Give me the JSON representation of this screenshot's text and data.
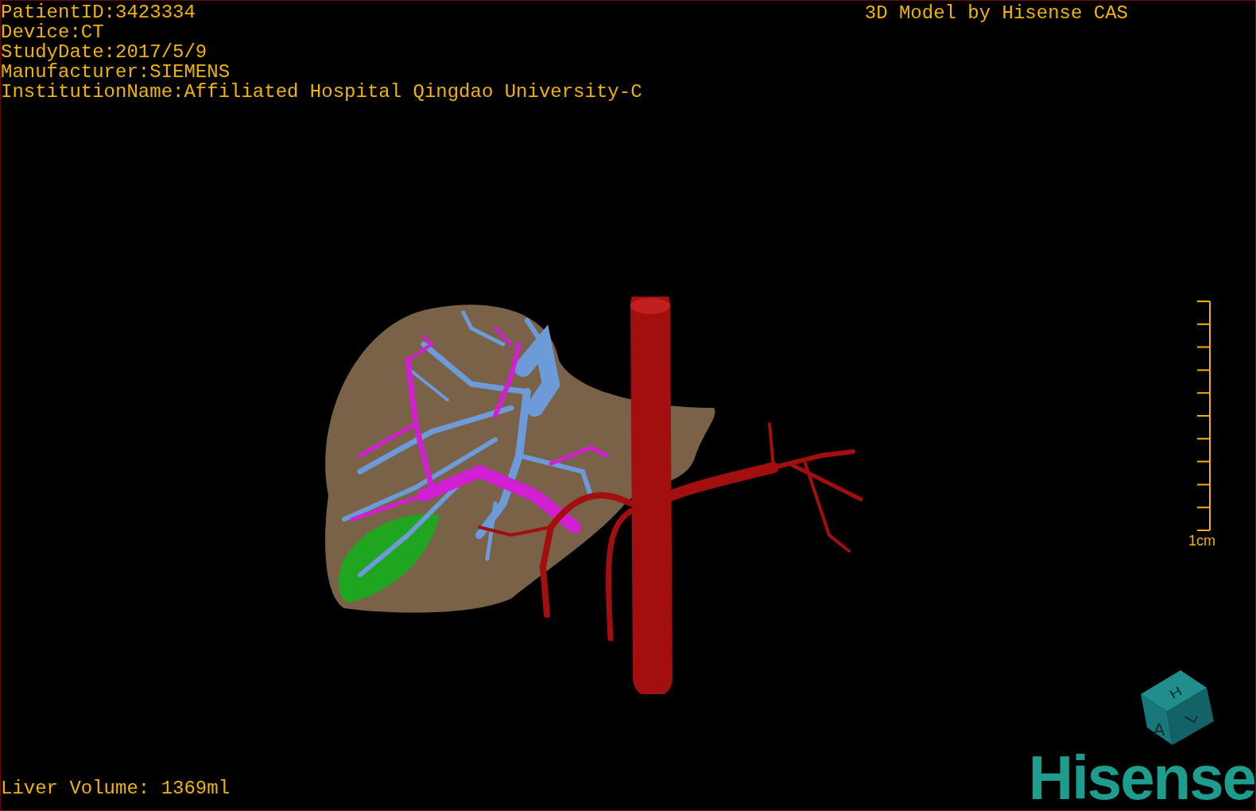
{
  "patient_info": [
    "PatientID:3423334",
    "Device:CT",
    "StudyDate:2017/5/9",
    "Manufacturer:SIEMENS",
    "InstitutionName:Affiliated Hospital Qingdao University-C"
  ],
  "viewer_title": "3D Model by Hisense CAS",
  "scale_bar": {
    "label": "1cm"
  },
  "liver_volume": "Liver Volume: 1369ml",
  "orientation_cube": {
    "top_label": "H",
    "front_label": "A",
    "side_label": "L"
  },
  "logo": "Hisense"
}
